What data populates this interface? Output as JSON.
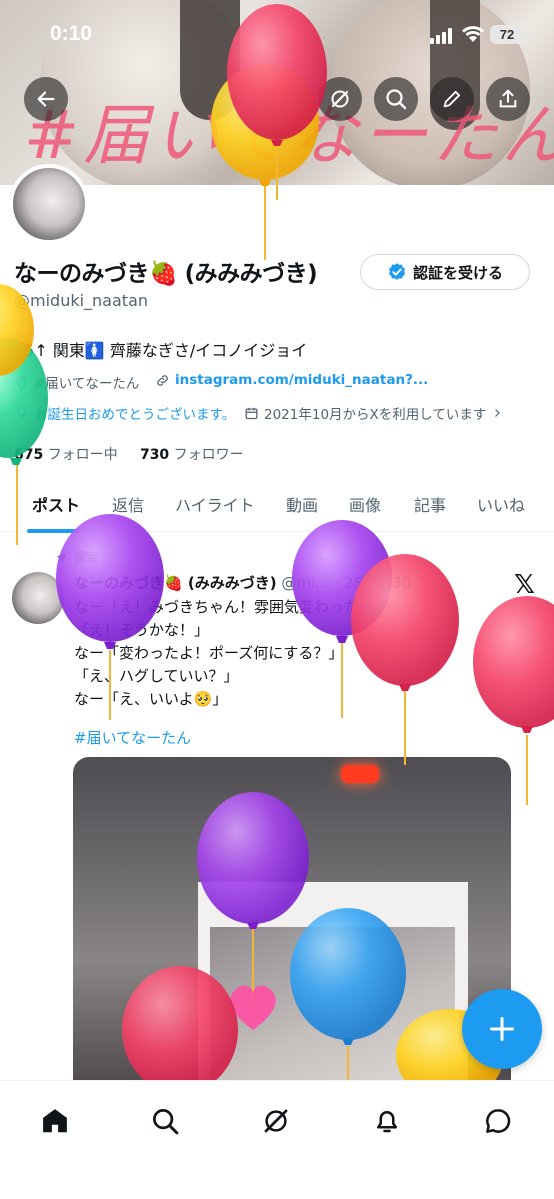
{
  "status_bar": {
    "time": "0:10",
    "battery": "72"
  },
  "header": {
    "banner_text": "#届いてなーたん",
    "buttons": [
      "back",
      "grok",
      "search",
      "edit",
      "share"
    ]
  },
  "profile": {
    "display_name": "なーのみづき🍓 (みみみづき)",
    "handle": "@miduki_naatan",
    "verify_button": "認証を受ける",
    "bio": "25↑ 関東🚺 齊藤なぎさ/イコノイジョイ",
    "location": "#届いてなーたん",
    "link": "instagram.com/miduki_naatan?...",
    "birthday": "お誕生日おめでとうございます。",
    "joined": "2021年10月からXを利用しています",
    "following_count": "675",
    "following_label": "フォロー中",
    "followers_count": "730",
    "followers_label": "フォロワー"
  },
  "tabs": [
    "ポスト",
    "返信",
    "ハイライト",
    "動画",
    "画像",
    "記事",
    "いいね"
  ],
  "active_tab": "ポスト",
  "pinned_post": {
    "pinned_label": "固定",
    "author_name": "なーのみづき🍓 (みみみづき)",
    "author_handle_date": "@mi... · 25/03/30",
    "lines": [
      "なー「え！みづきちゃん！雰囲気変わった?」",
      "「え！そうかな！」",
      "なー「変わったよ！ポーズ何にする？」",
      "「え、ハグしていい？」",
      "なー「え、いいよ🥺」"
    ],
    "hashtag": "#届いてなーたん"
  },
  "fab_label": "+",
  "bottom_nav": [
    "home-icon",
    "search-icon",
    "grok-icon",
    "notifications-icon",
    "messages-icon"
  ],
  "colors": {
    "accent": "#1d9bf0",
    "text": "#0f1419",
    "secondary": "#536471",
    "balloon_red": "#f5466b",
    "balloon_yellow": "#ffd21f",
    "balloon_purple": "#9b3cf0",
    "balloon_blue": "#33a3f4",
    "balloon_green": "#2fd89a"
  }
}
